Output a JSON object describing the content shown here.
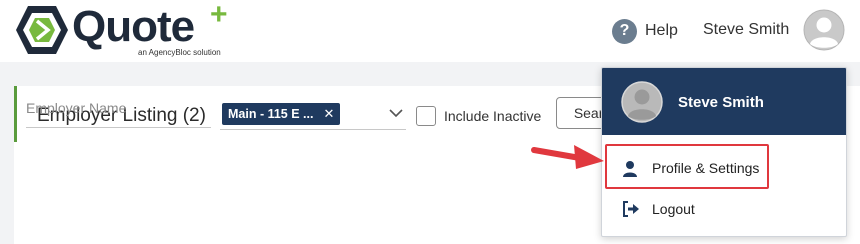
{
  "brand": {
    "name": "Quote",
    "plus": "+",
    "tagline": "an AgencyBloc solution",
    "colors": {
      "primary": "#1f2a3a",
      "accent": "#78b93e"
    }
  },
  "header": {
    "help_label": "Help",
    "user_name": "Steve Smith"
  },
  "page": {
    "title": "Employer Listing (2)"
  },
  "filters": {
    "employer_name_placeholder": "Employer Name",
    "location_chip": "Main - 115 E ...",
    "include_inactive_label": "Include Inactive",
    "search_label": "Search"
  },
  "user_menu": {
    "name": "Steve Smith",
    "items": [
      {
        "label": "Profile & Settings",
        "icon": "user-icon"
      },
      {
        "label": "Logout",
        "icon": "sign-out-icon"
      }
    ],
    "header_color": "#1f3a5f"
  },
  "annotation": {
    "highlight_color": "#e0383e"
  }
}
